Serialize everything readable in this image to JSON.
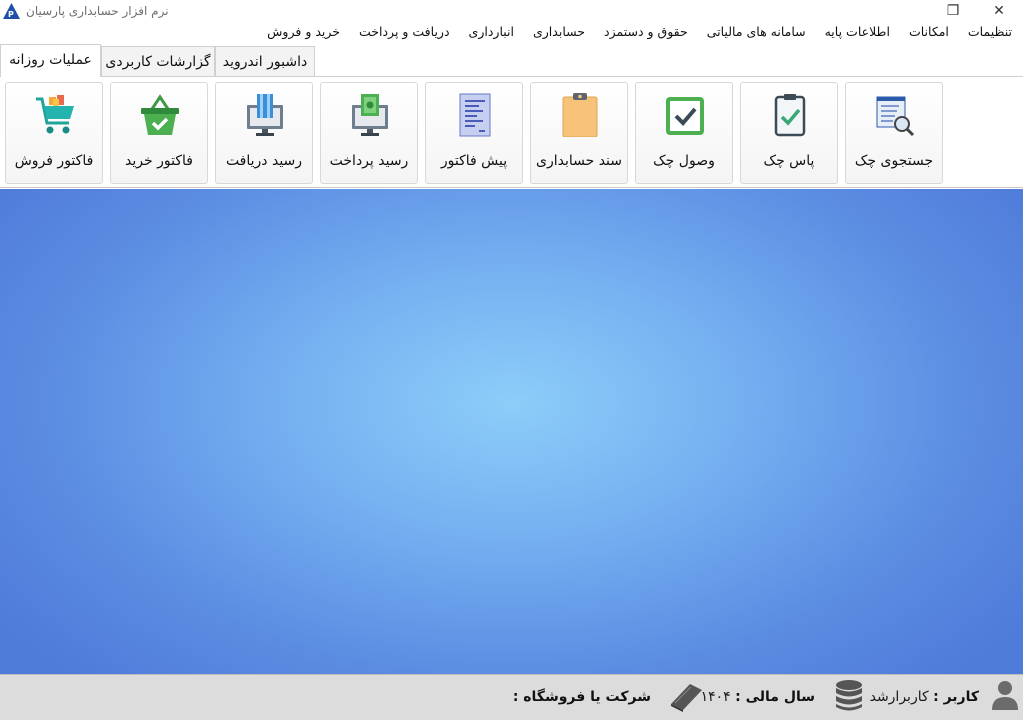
{
  "window": {
    "title": "نرم افزار حسابداری پارسیان",
    "restore_glyph": "❐",
    "close_glyph": "✕"
  },
  "menu": [
    "خرید و فروش",
    "دریافت و پرداخت",
    "انبارداری",
    "حسابداری",
    "حقوق و دستمزد",
    "سامانه های مالیاتی",
    "اطلاعات پایه",
    "امکانات",
    "تنظیمات"
  ],
  "tabs": {
    "daily": "عملیات روزانه",
    "reports": "گزارشات کاربردی",
    "dashboard": "داشبور اندروید"
  },
  "toolbar": {
    "check_search": "جستجوی چک",
    "check_pass": "پاس چک",
    "check_collect": "وصول چک",
    "voucher": "سند حسابداری",
    "proforma": "پیش فاکتور",
    "payment_receipt": "رسید پرداخت",
    "receive_receipt": "رسید دریافت",
    "purchase_invoice": "فاکتور خرید",
    "sales_invoice": "فاکتور فروش"
  },
  "icons": {
    "check_search": "search-document-icon",
    "check_pass": "clipboard-check-icon",
    "check_collect": "checkbox-icon",
    "voucher": "clipboard-icon",
    "proforma": "document-icon",
    "payment_receipt": "monitor-cash-icon",
    "receive_receipt": "monitor-card-icon",
    "purchase_invoice": "basket-check-icon",
    "sales_invoice": "cart-icon"
  },
  "status": {
    "user_label": "کاربر :",
    "user_value": "کاربرارشد",
    "year_label": "سال مالی :",
    "year_value": "۱۴۰۴",
    "company_label": "شرکت یا فروشگاه :",
    "company_value": ""
  },
  "colors": {
    "desktop_center": "#8ccdf9",
    "desktop_edge": "#4f7bd9",
    "accent_green": "#4caf50",
    "accent_blue": "#2b6cb0"
  }
}
